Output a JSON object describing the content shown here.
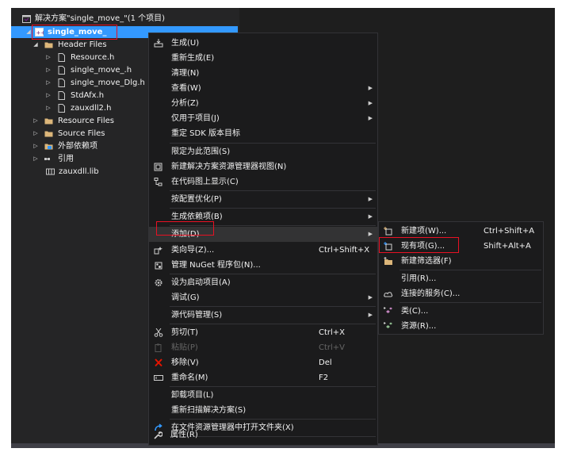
{
  "solution_explorer": {
    "solution_label": "解决方案\"single_move_\"(1 个项目)",
    "project_label": "single_move_",
    "items": [
      {
        "label": "Header Files",
        "icon": "filter-folder-icon"
      },
      {
        "label": "Resource.h",
        "icon": "header-file-icon"
      },
      {
        "label": "single_move_.h",
        "icon": "header-file-icon"
      },
      {
        "label": "single_move_Dlg.h",
        "icon": "header-file-icon"
      },
      {
        "label": "StdAfx.h",
        "icon": "header-file-icon"
      },
      {
        "label": "zauxdll2.h",
        "icon": "header-file-icon"
      },
      {
        "label": "Resource Files",
        "icon": "filter-folder-icon"
      },
      {
        "label": "Source Files",
        "icon": "filter-folder-icon"
      },
      {
        "label": "外部依赖项",
        "icon": "external-deps-icon"
      },
      {
        "label": "引用",
        "icon": "references-icon"
      },
      {
        "label": "zauxdll.lib",
        "icon": "library-file-icon"
      }
    ]
  },
  "context_menu": {
    "items": [
      {
        "label": "生成(U)",
        "shortcut": "",
        "icon": "build-icon"
      },
      {
        "label": "重新生成(E)",
        "shortcut": ""
      },
      {
        "label": "清理(N)",
        "shortcut": ""
      },
      {
        "label": "查看(W)",
        "shortcut": ""
      },
      {
        "label": "分析(Z)",
        "shortcut": ""
      },
      {
        "label": "仅用于项目(J)",
        "shortcut": ""
      },
      {
        "label": "重定 SDK 版本目标",
        "shortcut": ""
      },
      {
        "label": "限定为此范围(S)",
        "shortcut": ""
      },
      {
        "label": "新建解决方案资源管理器视图(N)",
        "shortcut": "",
        "icon": "new-view-icon"
      },
      {
        "label": "在代码图上显示(C)",
        "shortcut": "",
        "icon": "code-map-icon"
      },
      {
        "label": "按配置优化(P)",
        "shortcut": ""
      },
      {
        "label": "生成依赖项(B)",
        "shortcut": ""
      },
      {
        "label": "添加(D)",
        "shortcut": ""
      },
      {
        "label": "类向导(Z)...",
        "shortcut": "Ctrl+Shift+X",
        "icon": "class-wizard-icon"
      },
      {
        "label": "管理 NuGet 程序包(N)...",
        "shortcut": "",
        "icon": "nuget-icon"
      },
      {
        "label": "设为启动项目(A)",
        "shortcut": "",
        "icon": "gear-icon"
      },
      {
        "label": "调试(G)",
        "shortcut": ""
      },
      {
        "label": "源代码管理(S)",
        "shortcut": ""
      },
      {
        "label": "剪切(T)",
        "shortcut": "Ctrl+X",
        "icon": "scissors-icon"
      },
      {
        "label": "粘贴(P)",
        "shortcut": "Ctrl+V",
        "icon": "paste-icon"
      },
      {
        "label": "移除(V)",
        "shortcut": "Del",
        "icon": "remove-icon"
      },
      {
        "label": "重命名(M)",
        "shortcut": "F2",
        "icon": "rename-icon"
      },
      {
        "label": "卸载项目(L)",
        "shortcut": ""
      },
      {
        "label": "重新扫描解决方案(S)",
        "shortcut": ""
      },
      {
        "label": "在文件资源管理器中打开文件夹(X)",
        "shortcut": "",
        "icon": "open-folder-arrow-icon"
      },
      {
        "label": "属性(R)",
        "shortcut": "",
        "icon": "wrench-icon"
      }
    ]
  },
  "add_submenu": {
    "items": [
      {
        "label": "新建项(W)...",
        "shortcut": "Ctrl+Shift+A",
        "icon": "new-item-icon"
      },
      {
        "label": "现有项(G)...",
        "shortcut": "Shift+Alt+A",
        "icon": "existing-item-icon"
      },
      {
        "label": "新建筛选器(F)",
        "shortcut": "",
        "icon": "new-filter-icon"
      },
      {
        "label": "引用(R)...",
        "shortcut": ""
      },
      {
        "label": "连接的服务(C)...",
        "shortcut": "",
        "icon": "connected-service-icon"
      },
      {
        "label": "类(C)...",
        "shortcut": "",
        "icon": "class-icon"
      },
      {
        "label": "资源(R)...",
        "shortcut": "",
        "icon": "resource-icon"
      }
    ]
  },
  "colors": {
    "selection": "#3399ff",
    "menu_background": "#1b1b1c",
    "highlight_border": "#e81123",
    "folder_yellow": "#dcb67a"
  }
}
